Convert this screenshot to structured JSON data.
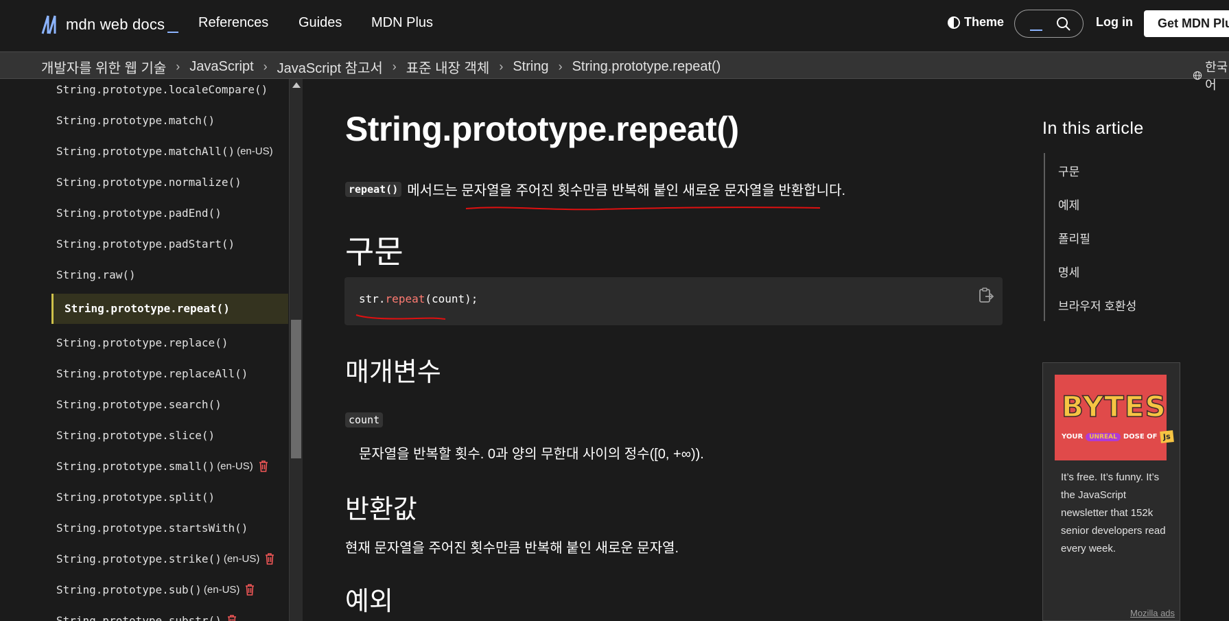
{
  "header": {
    "logo_text": "mdn web docs",
    "nav": [
      "References",
      "Guides",
      "MDN Plus"
    ],
    "theme_label": "Theme",
    "login_label": "Log in",
    "get_plus_label": "Get MDN Plus"
  },
  "breadcrumbs": [
    "개발자를 위한 웹 기술",
    "JavaScript",
    "JavaScript 참고서",
    "표준 내장 객체",
    "String",
    "String.prototype.repeat()"
  ],
  "language": "한국어",
  "sidebar": {
    "items": [
      {
        "label": "String.prototype.localeCompare()"
      },
      {
        "label": "String.prototype.match()"
      },
      {
        "label": "String.prototype.matchAll()",
        "tag": "(en-US)"
      },
      {
        "label": "String.prototype.normalize()"
      },
      {
        "label": "String.prototype.padEnd()"
      },
      {
        "label": "String.prototype.padStart()"
      },
      {
        "label": "String.raw()"
      },
      {
        "label": "String.prototype.repeat()",
        "active": true
      },
      {
        "label": "String.prototype.replace()"
      },
      {
        "label": "String.prototype.replaceAll()"
      },
      {
        "label": "String.prototype.search()"
      },
      {
        "label": "String.prototype.slice()"
      },
      {
        "label": "String.prototype.small()",
        "tag": "(en-US)",
        "deprecated": true
      },
      {
        "label": "String.prototype.split()"
      },
      {
        "label": "String.prototype.startsWith()"
      },
      {
        "label": "String.prototype.strike()",
        "tag": "(en-US)",
        "deprecated": true
      },
      {
        "label": "String.prototype.sub()",
        "tag": "(en-US)",
        "deprecated": true
      },
      {
        "label": "String.prototype.substr()",
        "deprecated": true
      }
    ]
  },
  "article": {
    "title": "String.prototype.repeat()",
    "intro_code": "repeat()",
    "intro_text": "메서드는 문자열을 주어진 횟수만큼 반복해 붙인 새로운 문자열을 반환합니다.",
    "syntax_heading": "구문",
    "syntax_code": {
      "obj": "str",
      "dot": ".",
      "fn": "repeat",
      "args": "(count);"
    },
    "params_heading": "매개변수",
    "param_name": "count",
    "param_desc": "문자열을 반복할 횟수. 0과 양의 무한대 사이의 정수([0, +∞)).",
    "return_heading": "반환값",
    "return_desc": "현재 문자열을 주어진 횟수만큼 반복해 붙인 새로운 문자열.",
    "exceptions_heading": "예외"
  },
  "toc": {
    "title": "In this article",
    "items": [
      "구문",
      "예제",
      "폴리필",
      "명세",
      "브라우저 호환성"
    ]
  },
  "ad": {
    "logo_word": "BYTES",
    "tagline_left": "YOUR",
    "tagline_pill": "UNREAL",
    "tagline_right": "DOSE OF",
    "tagline_badge": "Js",
    "text": "It’s free. It’s funny. It’s the JavaScript newsletter that 152k senior developers read every week.",
    "credit": "Mozilla ads"
  },
  "colors": {
    "background": "#1b1b1b",
    "accent_link": "#8cb4ff",
    "active_border": "#cfc24a",
    "annotation": "#e01010"
  }
}
